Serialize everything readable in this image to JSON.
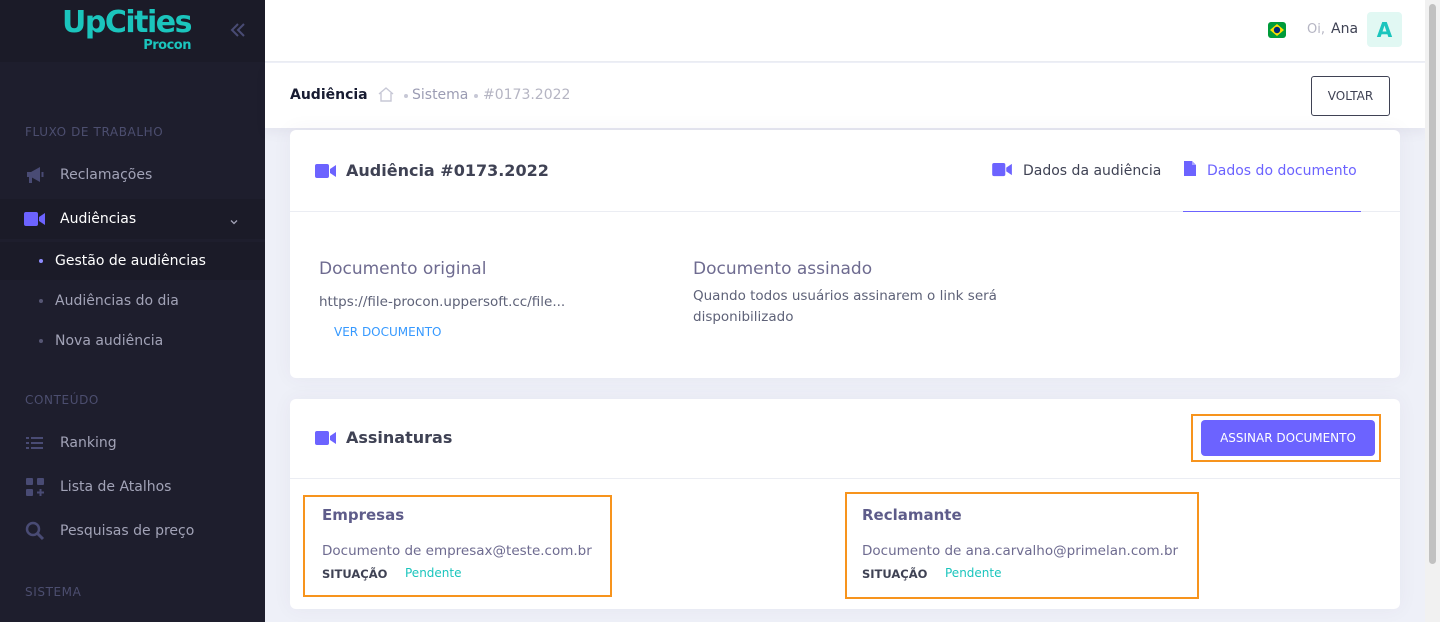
{
  "brand": {
    "name": "UpCities",
    "sub": "Procon"
  },
  "sidebar": {
    "sections": [
      "FLUXO DE TRABALHO",
      "CONTEÚDO",
      "SISTEMA"
    ],
    "items": [
      {
        "label": "Reclamações",
        "icon": "megaphone-icon"
      },
      {
        "label": "Audiências",
        "icon": "video-camera-icon"
      },
      {
        "label": "Ranking",
        "icon": "list-icon"
      },
      {
        "label": "Lista de Atalhos",
        "icon": "shortcuts-icon"
      },
      {
        "label": "Pesquisas de preço",
        "icon": "search-icon"
      }
    ],
    "subitems": [
      "Gestão de audiências",
      "Audiências do dia",
      "Nova audiência"
    ]
  },
  "header": {
    "greeting": "Oi,",
    "user": "Ana",
    "avatar_letter": "A"
  },
  "subheader": {
    "title": "Audiência",
    "crumbs": [
      "Sistema",
      "#0173.2022"
    ],
    "back_label": "VOLTAR"
  },
  "card1": {
    "title": "Audiência #0173.2022",
    "tabs": [
      "Dados da audiência",
      "Dados do documento"
    ],
    "original": {
      "heading": "Documento original",
      "url": "https://file-procon.uppersoft.cc/file...",
      "link": "VER DOCUMENTO"
    },
    "signed": {
      "heading": "Documento assinado",
      "text": "Quando todos usuários assinarem o link será disponibilizado"
    }
  },
  "card2": {
    "title": "Assinaturas",
    "sign_button": "ASSINAR DOCUMENTO",
    "parties": [
      {
        "title": "Empresas",
        "doc": "Documento de empresax@teste.com.br",
        "status_label": "SITUAÇÃO",
        "status": "Pendente"
      },
      {
        "title": "Reclamante",
        "doc": "Documento de ana.carvalho@primelan.com.br",
        "status_label": "SITUAÇÃO",
        "status": "Pendente"
      }
    ]
  },
  "colors": {
    "accent": "#6c63ff",
    "brand": "#1bc5bd",
    "sidebar": "#1e1e2d",
    "highlight": "#f7941d"
  }
}
